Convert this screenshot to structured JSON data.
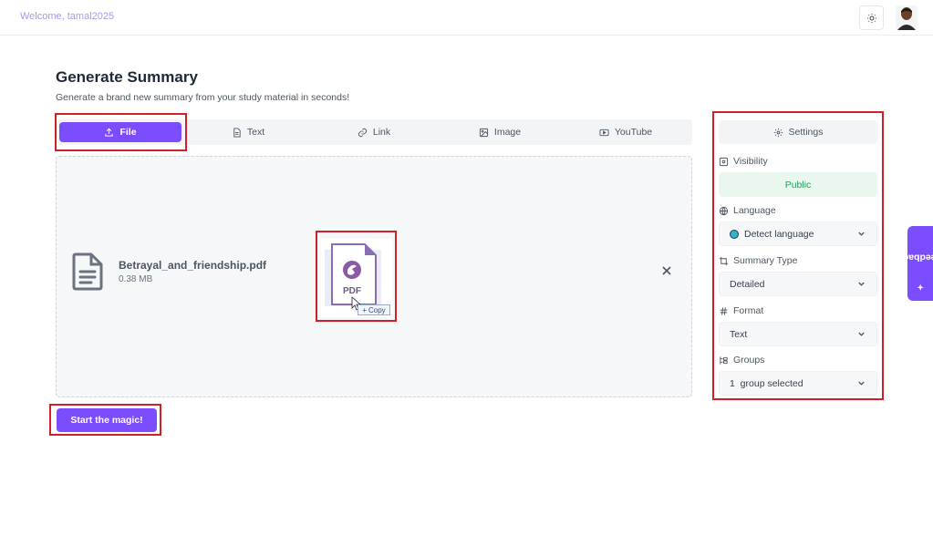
{
  "header": {
    "welcome": "Welcome, tamal2025",
    "theme_icon": "sun-icon"
  },
  "page": {
    "title": "Generate Summary",
    "subtitle": "Generate a brand new summary from your study material in seconds!"
  },
  "tabs": [
    {
      "label": "File",
      "icon": "upload-icon",
      "active": true
    },
    {
      "label": "Text",
      "icon": "document-icon",
      "active": false
    },
    {
      "label": "Link",
      "icon": "link-icon",
      "active": false
    },
    {
      "label": "Image",
      "icon": "image-icon",
      "active": false
    },
    {
      "label": "YouTube",
      "icon": "youtube-icon",
      "active": false
    }
  ],
  "upload": {
    "file_name": "Betrayal_and_friendship.pdf",
    "file_size": "0.38 MB",
    "drag_preview_label": "PDF",
    "drag_copy_label": "Copy"
  },
  "actions": {
    "start_label": "Start the magic!"
  },
  "settings": {
    "header": "Settings",
    "visibility_label": "Visibility",
    "visibility_value": "Public",
    "language_label": "Language",
    "language_value": "Detect language",
    "summary_type_label": "Summary Type",
    "summary_type_value": "Detailed",
    "format_label": "Format",
    "format_value": "Text",
    "groups_label": "Groups",
    "groups_value": "1  group selected"
  },
  "feedback": {
    "label": "Feedback"
  },
  "colors": {
    "accent": "#7c4dff",
    "highlight": "#d01f28",
    "public_green": "#22a35a"
  }
}
